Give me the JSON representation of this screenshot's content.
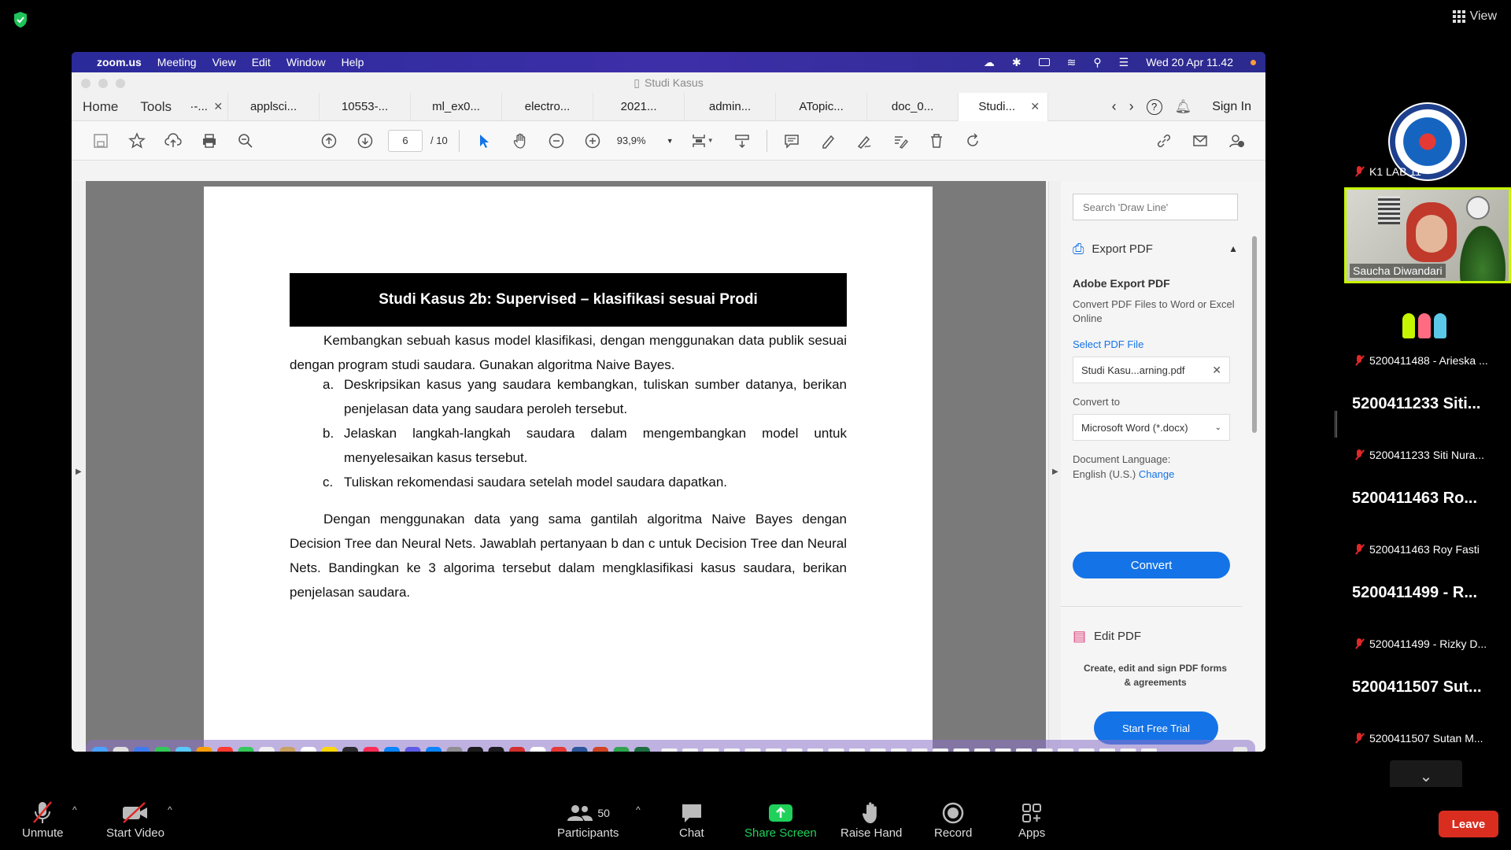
{
  "zoom": {
    "view_label": "View",
    "bottombar": {
      "unmute": "Unmute",
      "start_video": "Start Video",
      "participants_count": "50",
      "participants": "Participants",
      "chat": "Chat",
      "share_screen": "Share Screen",
      "raise_hand": "Raise Hand",
      "record": "Record",
      "apps": "Apps",
      "leave": "Leave"
    },
    "participants": [
      {
        "name": "K1 LAB 11"
      },
      {
        "name": "Saucha Diwandari"
      },
      {
        "name": "5200411488 - Arieska ..."
      },
      {
        "display": "5200411233 Siti...",
        "name": "5200411233 Siti Nura..."
      },
      {
        "display": "5200411463 Ro...",
        "name": "5200411463 Roy Fasti"
      },
      {
        "display": "5200411499 - R...",
        "name": "5200411499 - Rizky D..."
      },
      {
        "display": "5200411507 Sut...",
        "name": "5200411507 Sutan M..."
      }
    ]
  },
  "mac": {
    "app": "zoom.us",
    "menus": [
      "Meeting",
      "View",
      "Edit",
      "Window",
      "Help"
    ],
    "clock": "Wed 20 Apr  11.42"
  },
  "acrobat": {
    "window_title": "Studi Kasus",
    "nav": {
      "home": "Home",
      "tools": "Tools"
    },
    "tabs": [
      {
        "label": "·-..."
      },
      {
        "label": "applsci..."
      },
      {
        "label": "10553-..."
      },
      {
        "label": "ml_ex0..."
      },
      {
        "label": "electro..."
      },
      {
        "label": "2021..."
      },
      {
        "label": "admin..."
      },
      {
        "label": "ATopic..."
      },
      {
        "label": "doc_0..."
      },
      {
        "label": "Studi..."
      }
    ],
    "sign_in": "Sign In",
    "page_current": "6",
    "page_total": "/ 10",
    "zoom": "93,9%",
    "document": {
      "banner": "Studi Kasus 2b: Supervised – klasifikasi sesuai Prodi",
      "para1": "Kembangkan sebuah kasus model klasifikasi, dengan menggunakan data publik sesuai dengan program studi saudara. Gunakan algoritma Naive Bayes.",
      "items": [
        {
          "n": "a.",
          "t": "Deskripsikan kasus yang saudara kembangkan, tuliskan sumber datanya, berikan penjelasan data yang saudara peroleh tersebut."
        },
        {
          "n": "b.",
          "t": "Jelaskan langkah-langkah saudara dalam mengembangkan model untuk menyelesaikan kasus tersebut."
        },
        {
          "n": "c.",
          "t": "Tuliskan rekomendasi saudara setelah model saudara dapatkan."
        }
      ],
      "para2": "Dengan menggunakan data yang sama gantilah algoritma Naive Bayes dengan Decision Tree dan Neural Nets. Jawablah pertanyaan b dan c untuk Decision Tree dan Neural Nets. Bandingkan ke 3 algorima tersebut dalam mengklasifikasi kasus saudara, berikan penjelasan saudara."
    },
    "panel": {
      "search_placeholder": "Search 'Draw Line'",
      "export_pdf": "Export PDF",
      "adobe_export": "Adobe Export PDF",
      "export_desc": "Convert PDF Files to Word or Excel Online",
      "select_pdf": "Select PDF File",
      "file_name": "Studi Kasu...arning.pdf",
      "convert_to": "Convert to",
      "format": "Microsoft Word (*.docx)",
      "doc_lang_label": "Document Language:",
      "doc_lang": "English (U.S.)",
      "change": "Change",
      "convert": "Convert",
      "edit_pdf": "Edit PDF",
      "edit_desc": "Create, edit and sign PDF forms & agreements",
      "trial": "Start Free Trial"
    }
  }
}
